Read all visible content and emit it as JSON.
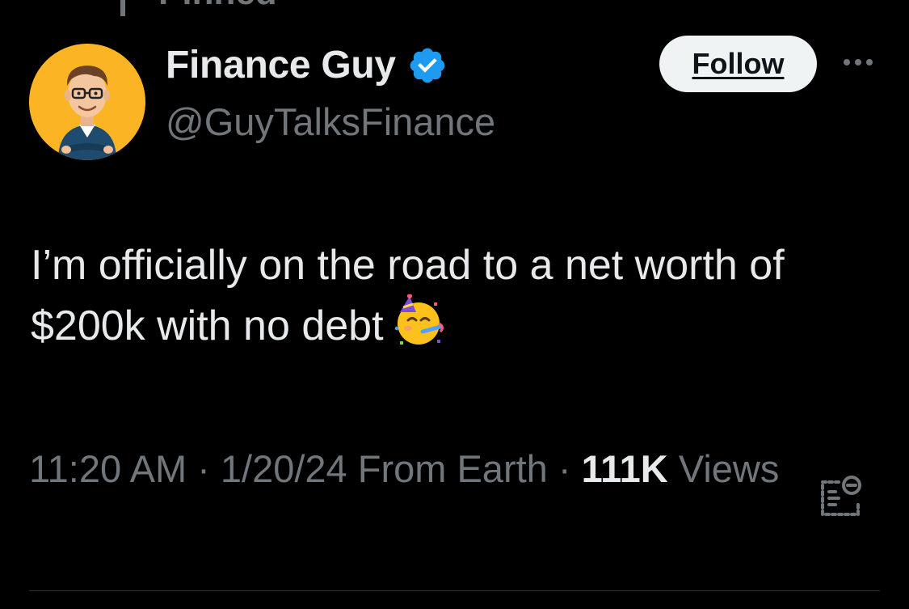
{
  "pinned": {
    "label": "Pinned",
    "icon": "pin-icon"
  },
  "author": {
    "display_name": "Finance Guy",
    "handle": "@GuyTalksFinance",
    "verified": true,
    "verified_icon": "verified-badge-icon",
    "avatar_icon": "cartoon-avatar"
  },
  "follow_button": {
    "label": "Follow"
  },
  "more_options": {
    "icon": "more-horizontal-icon"
  },
  "tweet": {
    "text": "I’m officially on the road to a net worth of $200k with no debt",
    "emoji": "🥳"
  },
  "meta": {
    "time": "11:20 AM",
    "separator_1": " · ",
    "date": "1/20/24",
    "source": " From Earth",
    "separator_2": " · ",
    "views_count": "111K",
    "views_label": " Views"
  },
  "analytics": {
    "icon": "view-analytics-icon"
  },
  "colors": {
    "background": "#000000",
    "primary_text": "#e7e9ea",
    "secondary_text": "#71767b",
    "verified_blue": "#1d9bf0",
    "follow_bg": "#eff3f4",
    "avatar_bg": "#fbb424"
  }
}
